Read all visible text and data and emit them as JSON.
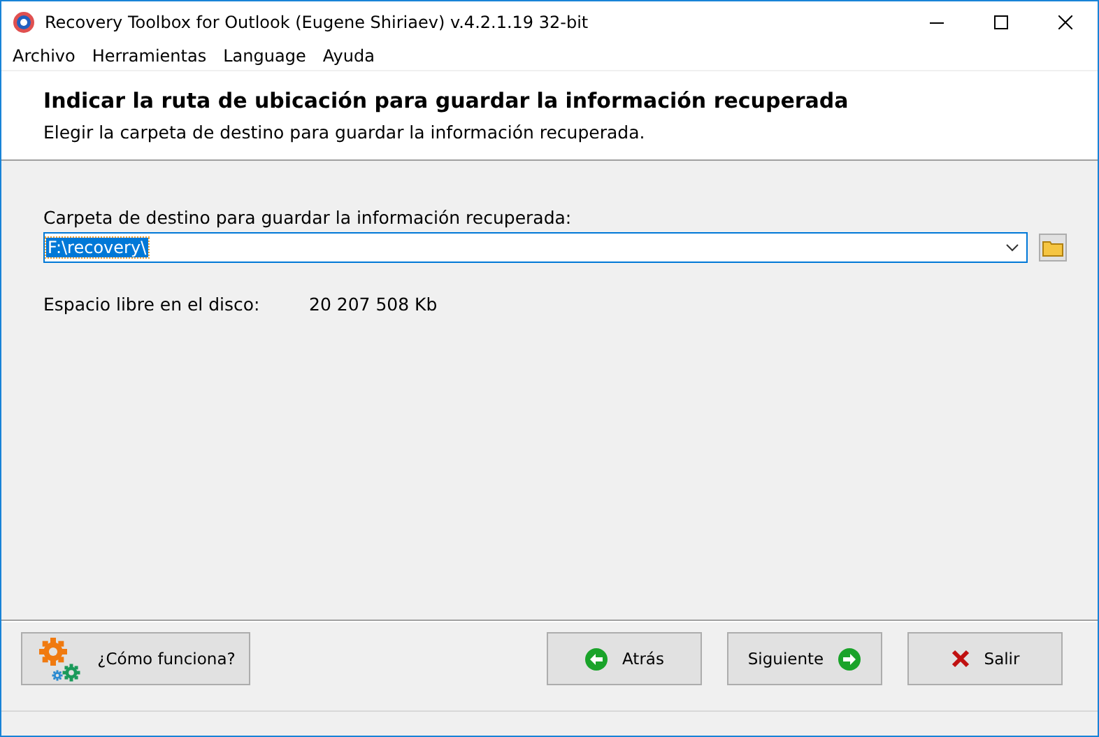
{
  "window": {
    "title": "Recovery Toolbox for Outlook (Eugene Shiriaev) v.4.2.1.19 32-bit"
  },
  "menu": [
    "Archivo",
    "Herramientas",
    "Language",
    "Ayuda"
  ],
  "header": {
    "title": "Indicar la ruta de ubicación para guardar la información recuperada",
    "subtitle": "Elegir la carpeta de destino para guardar la información recuperada."
  },
  "folder": {
    "label": "Carpeta de destino para guardar la información recuperada:",
    "value": "F:\\recovery\\",
    "highlighted": true
  },
  "free_space": {
    "label": "Espacio libre en el disco:",
    "value": "20 207 508 Kb"
  },
  "buttons": [
    {
      "kind": "help",
      "label": "¿Cómo funciona?"
    },
    {
      "kind": "back",
      "label": "Atrás"
    },
    {
      "kind": "next",
      "label": "Siguiente"
    },
    {
      "kind": "exit",
      "label": "Salir"
    }
  ]
}
